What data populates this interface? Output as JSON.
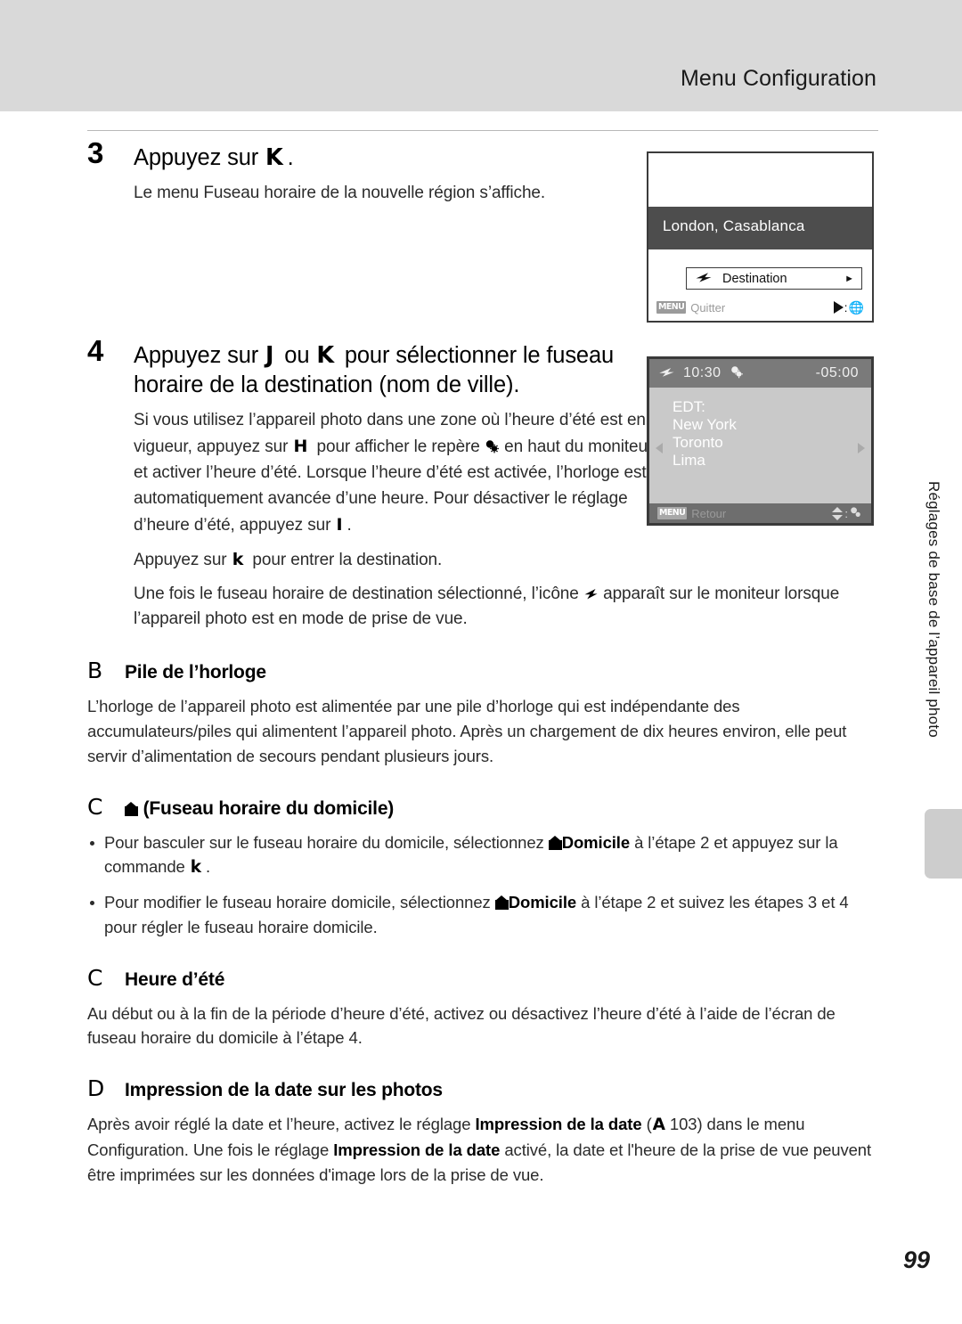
{
  "header": {
    "title": "Menu Configuration"
  },
  "steps": [
    {
      "number": "3",
      "title_pre": "Appuyez sur ",
      "title_sym": "K",
      "title_post": ".",
      "text": "Le menu Fuseau horaire de la nouvelle région s’affiche."
    },
    {
      "number": "4",
      "title_pre": "Appuyez sur ",
      "title_sym_a": "J",
      "title_mid": " ou ",
      "title_sym_b": "K",
      "title_post": " pour sélectionner le fuseau horaire de la destination (nom de ville).",
      "para1_a": "Si vous utilisez l’appareil photo dans une zone où l’heure d’été est en vigueur, appuyez sur ",
      "para1_sym": "H",
      "para1_b": " pour afficher le repère ",
      "para1_icon": "sun-clock-icon",
      "para1_c": " en haut du moniteur et activer l’heure d’été. Lorsque l’heure d’été est activée, l’horloge est automatiquement avancée d’une heure. Pour désactiver le réglage d’heure d’été, appuyez sur ",
      "para1_sym2": "I",
      "para1_d": ".",
      "para2_a": "Appuyez sur ",
      "para2_sym": "k",
      "para2_b": " pour entrer la destination.",
      "para3_a": "Une fois le fuseau horaire de destination sélectionné, l’icône ",
      "para3_icon": "destination-plane-icon",
      "para3_b": " apparaît sur le moniteur lorsque l’appareil photo est en mode de prise de vue."
    }
  ],
  "screen1": {
    "city": "London, Casablanca",
    "row_label": "Destination",
    "row_icon": "plane-icon",
    "row_arrow": "chevron-right-icon",
    "menu_chip": "MENU",
    "foot_label": "Quitter",
    "foot_right_icon": "play-globe-icon"
  },
  "screen2": {
    "plane_icon": "plane-icon",
    "time": "10:30",
    "dst_icon": "sun-clock-icon",
    "offset": "-05:00",
    "cities": [
      "EDT:",
      "New York",
      "Toronto",
      "Lima"
    ],
    "menu_chip": "MENU",
    "foot_label": "Retour",
    "foot_right_icon": "updown-clock-icon",
    "arrow_left": "chevron-left-icon",
    "arrow_right": "chevron-right-icon"
  },
  "notes": [
    {
      "mark": "B",
      "title": "Pile de l’horloge",
      "body": "L’horloge de l’appareil photo est alimentée par une pile d’horloge qui est indépendante des accumulateurs/piles qui alimentent l’appareil photo. Après un chargement de dix heures environ, elle peut servir d’alimentation de secours pendant plusieurs jours."
    },
    {
      "mark": "C",
      "title_icon": "home-icon",
      "title": "(Fuseau horaire du domicile)",
      "bullets": [
        {
          "a": "Pour basculer sur le fuseau horaire du domicile, sélectionnez ",
          "icon": "home-icon",
          "strong": "Domicile",
          "b": " à l’étape 2 et appuyez sur la commande ",
          "sym": "k",
          "c": "."
        },
        {
          "a": "Pour modifier le fuseau horaire domicile, sélectionnez ",
          "icon": "home-icon",
          "strong": "Domicile",
          "b": " à l’étape 2 et suivez les étapes 3 et 4 pour régler le fuseau horaire domicile.",
          "sym": "",
          "c": ""
        }
      ]
    },
    {
      "mark": "C",
      "title": "Heure d’été",
      "body": "Au début ou à la fin de la période d’heure d’été, activez ou désactivez l’heure d’été à l’aide de l’écran de fuseau horaire du domicile à l’étape 4."
    },
    {
      "mark": "D",
      "title": "Impression de la date sur les photos",
      "body_a": "Après avoir réglé la date et l’heure, activez le réglage ",
      "body_strong1": "Impression de la date",
      "body_b": " (",
      "body_sym": "A",
      "body_page": "103",
      "body_c": ") dans le menu Configuration. Une fois le réglage ",
      "body_strong2": "Impression de la date",
      "body_d": " activé, la date et l'heure de la prise de vue peuvent être imprimées sur les données d'image lors de la prise de vue."
    }
  ],
  "side_tab": {
    "label": "Réglages de base de l’appareil photo"
  },
  "page_number": "99",
  "colors": {
    "header_band": "#d9d9d9",
    "side_marker": "#cdcdcd",
    "screen_highlight": "#4d4d4d",
    "screen2_map": "#c9c9c9"
  }
}
